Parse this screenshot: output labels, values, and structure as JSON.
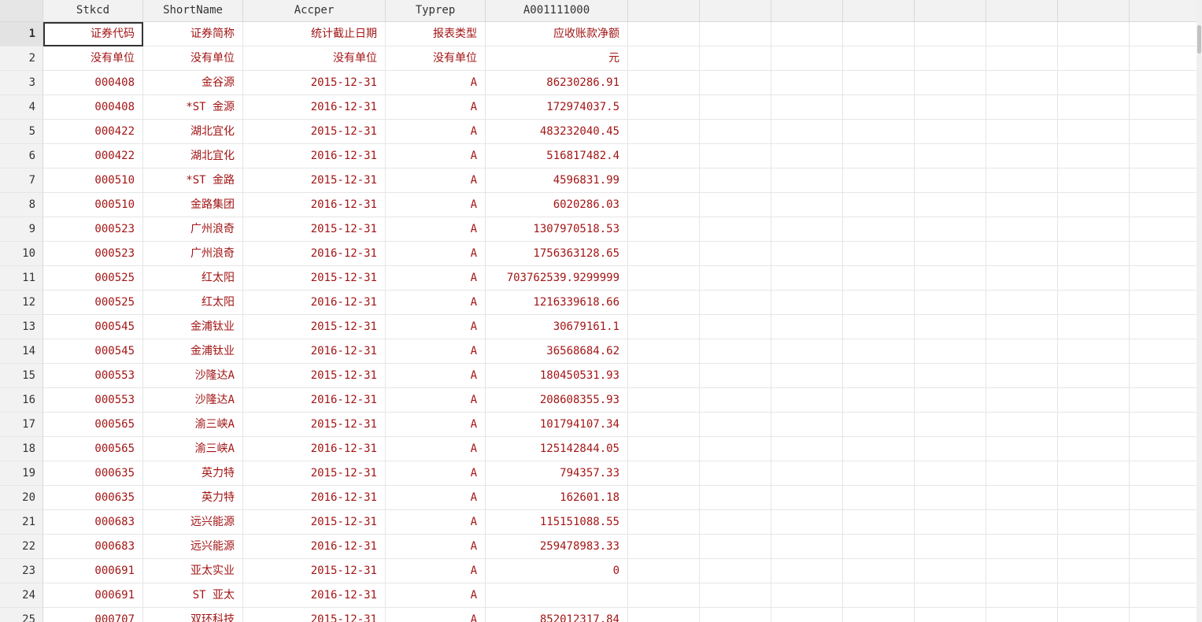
{
  "columns": [
    "Stkcd",
    "ShortName",
    "Accper",
    "Typrep",
    "A001111000",
    "",
    "",
    "",
    "",
    "",
    "",
    "",
    ""
  ],
  "rows": [
    {
      "n": "1",
      "c": [
        "证券代码",
        "证券简称",
        "统计截止日期",
        "报表类型",
        "应收账款净额"
      ]
    },
    {
      "n": "2",
      "c": [
        "没有单位",
        "没有单位",
        "没有单位",
        "没有单位",
        "元"
      ]
    },
    {
      "n": "3",
      "c": [
        "000408",
        "金谷源",
        "2015-12-31",
        "A",
        "86230286.91"
      ]
    },
    {
      "n": "4",
      "c": [
        "000408",
        "*ST 金源",
        "2016-12-31",
        "A",
        "172974037.5"
      ]
    },
    {
      "n": "5",
      "c": [
        "000422",
        "湖北宜化",
        "2015-12-31",
        "A",
        "483232040.45"
      ]
    },
    {
      "n": "6",
      "c": [
        "000422",
        "湖北宜化",
        "2016-12-31",
        "A",
        "516817482.4"
      ]
    },
    {
      "n": "7",
      "c": [
        "000510",
        "*ST 金路",
        "2015-12-31",
        "A",
        "4596831.99"
      ]
    },
    {
      "n": "8",
      "c": [
        "000510",
        "金路集团",
        "2016-12-31",
        "A",
        "6020286.03"
      ]
    },
    {
      "n": "9",
      "c": [
        "000523",
        "广州浪奇",
        "2015-12-31",
        "A",
        "1307970518.53"
      ]
    },
    {
      "n": "10",
      "c": [
        "000523",
        "广州浪奇",
        "2016-12-31",
        "A",
        "1756363128.65"
      ]
    },
    {
      "n": "11",
      "c": [
        "000525",
        "红太阳",
        "2015-12-31",
        "A",
        "703762539.9299999"
      ]
    },
    {
      "n": "12",
      "c": [
        "000525",
        "红太阳",
        "2016-12-31",
        "A",
        "1216339618.66"
      ]
    },
    {
      "n": "13",
      "c": [
        "000545",
        "金浦钛业",
        "2015-12-31",
        "A",
        "30679161.1"
      ]
    },
    {
      "n": "14",
      "c": [
        "000545",
        "金浦钛业",
        "2016-12-31",
        "A",
        "36568684.62"
      ]
    },
    {
      "n": "15",
      "c": [
        "000553",
        "沙隆达A",
        "2015-12-31",
        "A",
        "180450531.93"
      ]
    },
    {
      "n": "16",
      "c": [
        "000553",
        "沙隆达A",
        "2016-12-31",
        "A",
        "208608355.93"
      ]
    },
    {
      "n": "17",
      "c": [
        "000565",
        "渝三峡A",
        "2015-12-31",
        "A",
        "101794107.34"
      ]
    },
    {
      "n": "18",
      "c": [
        "000565",
        "渝三峡A",
        "2016-12-31",
        "A",
        "125142844.05"
      ]
    },
    {
      "n": "19",
      "c": [
        "000635",
        "英力特",
        "2015-12-31",
        "A",
        "794357.33"
      ]
    },
    {
      "n": "20",
      "c": [
        "000635",
        "英力特",
        "2016-12-31",
        "A",
        "162601.18"
      ]
    },
    {
      "n": "21",
      "c": [
        "000683",
        "远兴能源",
        "2015-12-31",
        "A",
        "115151088.55"
      ]
    },
    {
      "n": "22",
      "c": [
        "000683",
        "远兴能源",
        "2016-12-31",
        "A",
        "259478983.33"
      ]
    },
    {
      "n": "23",
      "c": [
        "000691",
        "亚太实业",
        "2015-12-31",
        "A",
        "0"
      ]
    },
    {
      "n": "24",
      "c": [
        "000691",
        "ST 亚太",
        "2016-12-31",
        "A",
        ""
      ]
    },
    {
      "n": "25",
      "c": [
        "000707",
        "双环科技",
        "2015-12-31",
        "A",
        "852012317.84"
      ]
    }
  ],
  "colors": {
    "cell_text": "#a31515",
    "header_bg": "#f2f2f2",
    "grid_line": "#e6e6e6"
  }
}
